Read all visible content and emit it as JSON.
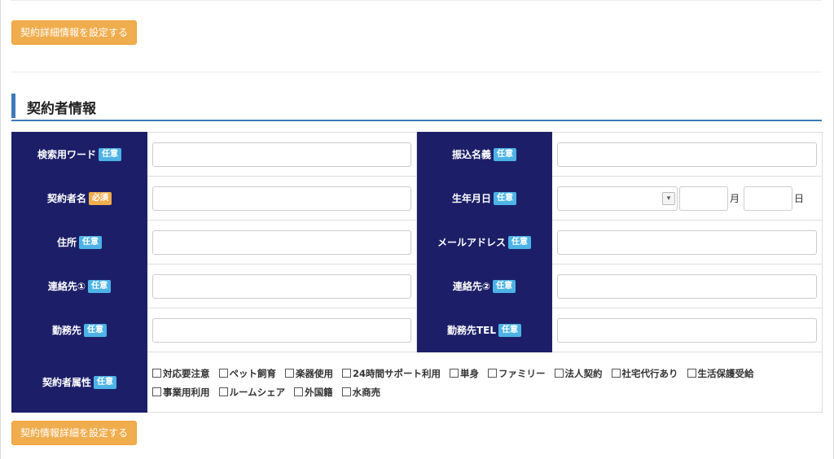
{
  "buttons": {
    "top_label": "契約詳細情報を設定する",
    "bottom_label": "契約情報詳細を設定する"
  },
  "section": {
    "title": "契約者情報"
  },
  "badges": {
    "optional": "任意",
    "required": "必須"
  },
  "fields": {
    "search_word": "検索用ワード",
    "transfer_name": "振込名義",
    "contractor_name": "契約者名",
    "birth_date": "生年月日",
    "address": "住所",
    "email": "メールアドレス",
    "contact1": "連絡先①",
    "contact2": "連絡先②",
    "workplace": "勤務先",
    "workplace_tel": "勤務先TEL",
    "attributes": "契約者属性"
  },
  "birth_units": {
    "month": "月",
    "day": "日"
  },
  "attributes": [
    "対応要注意",
    "ペット飼育",
    "楽器使用",
    "24時間サポート利用",
    "単身",
    "ファミリー",
    "法人契約",
    "社宅代行あり",
    "生活保護受給",
    "事業用利用",
    "ルームシェア",
    "外国籍",
    "水商売"
  ],
  "colors": {
    "label_bg": "#1c1f68",
    "button": "#f0ad4e",
    "optional_badge": "#4db3e6",
    "accent": "#3d7ab8"
  }
}
